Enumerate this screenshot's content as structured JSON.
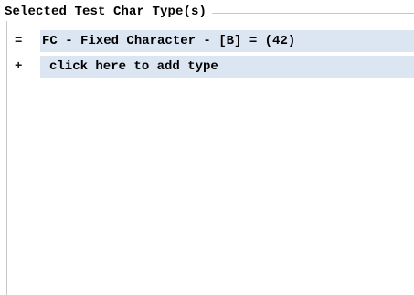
{
  "panel": {
    "legend": "Selected Test Char Type(s)"
  },
  "types": [
    {
      "marker": "=",
      "text": "FC - Fixed Character  - [B] = (42)"
    }
  ],
  "add": {
    "marker": "+",
    "label": "click here to add type"
  },
  "colors": {
    "row_background": "#dce6f2",
    "border": "#c8c8c8"
  }
}
